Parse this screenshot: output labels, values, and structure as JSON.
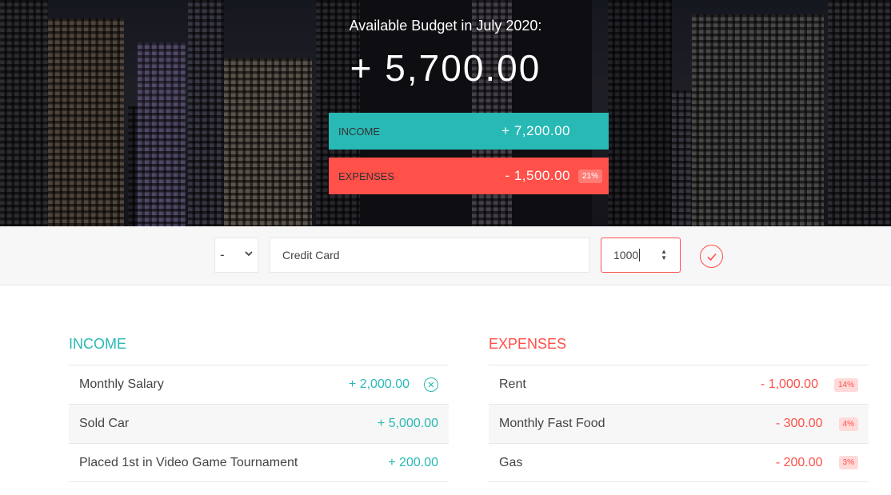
{
  "header": {
    "title": "Available Budget in July 2020:",
    "budget": "+ 5,700.00",
    "income_label": "INCOME",
    "income_value": "+ 7,200.00",
    "expenses_label": "EXPENSES",
    "expenses_value": "- 1,500.00",
    "expenses_percentage": "21%"
  },
  "add": {
    "type_value": "-",
    "description_value": "Credit Card",
    "amount_value": "1000"
  },
  "income": {
    "title": "INCOME",
    "items": [
      {
        "description": "Monthly Salary",
        "value": "+ 2,000.00"
      },
      {
        "description": "Sold Car",
        "value": "+ 5,000.00"
      },
      {
        "description": "Placed 1st in Video Game Tournament",
        "value": "+ 200.00"
      }
    ]
  },
  "expenses": {
    "title": "EXPENSES",
    "items": [
      {
        "description": "Rent",
        "value": "- 1,000.00",
        "percentage": "14%"
      },
      {
        "description": "Monthly Fast Food",
        "value": "- 300.00",
        "percentage": "4%"
      },
      {
        "description": "Gas",
        "value": "- 200.00",
        "percentage": "3%"
      }
    ]
  },
  "colors": {
    "income": "#28b9b5",
    "expenses": "#ff5049",
    "background_image": "city-skyline-night"
  }
}
